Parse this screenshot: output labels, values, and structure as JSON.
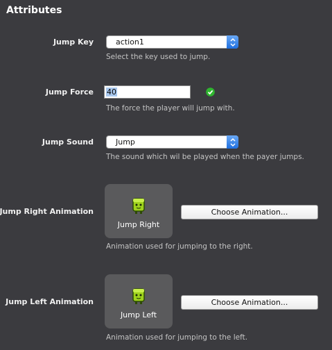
{
  "panel": {
    "title": "Attributes"
  },
  "jump_key": {
    "label": "Jump Key",
    "value": "action1",
    "hint": "Select the key used to jump."
  },
  "jump_force": {
    "label": "Jump Force",
    "value": "40",
    "hint": "The force the player will jump with."
  },
  "jump_sound": {
    "label": "Jump Sound",
    "value": "Jump",
    "hint": "The sound which wil be played when the payer jumps."
  },
  "jump_right": {
    "label": "Jump Right Animation",
    "preview_caption": "Jump Right",
    "button": "Choose Animation...",
    "hint": "Animation used for jumping to the right."
  },
  "jump_left": {
    "label": "Jump Left Animation",
    "preview_caption": "Jump Left",
    "button": "Choose Animation...",
    "hint": "Animation used for jumping to the left."
  },
  "icons": {
    "select_arrows": "up-down-arrows-icon",
    "valid": "checkmark-icon",
    "sprite": "character-sprite-icon"
  },
  "colors": {
    "background": "#3b3b3f",
    "select_accent": "#1f6fe0",
    "valid_green": "#2fb52f",
    "sprite_green": "#9ed21c"
  }
}
